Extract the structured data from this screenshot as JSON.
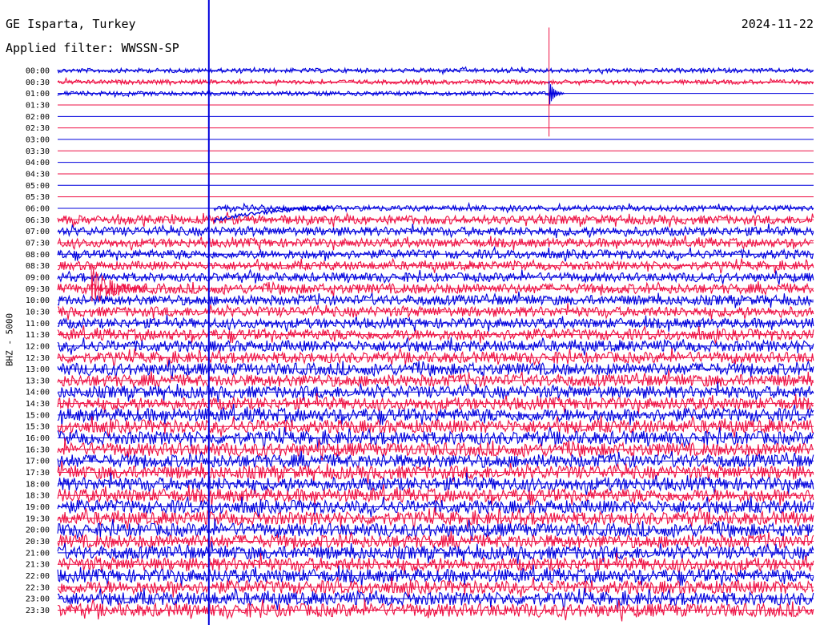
{
  "header": {
    "station": "GE Isparta, Turkey",
    "date": "2024-11-22",
    "filter": "Applied filter: WWSSN-SP"
  },
  "channel_label": "BHZ - 5000",
  "colors": {
    "even_row": "#0000dd",
    "odd_row": "#ee1144",
    "marker": "#0000dd",
    "text": "#000000"
  },
  "chart_data": {
    "type": "line",
    "title": "GE Isparta, Turkey",
    "subtitle": "Applied filter: WWSSN-SP",
    "ylabel": "BHZ - 5000",
    "x_axis": "minutes within each 30-minute trace line (0–30)",
    "y_tick_labels": [
      "00:00",
      "00:30",
      "01:00",
      "01:30",
      "02:00",
      "02:30",
      "03:00",
      "03:30",
      "04:00",
      "04:30",
      "05:00",
      "05:30",
      "06:00",
      "06:30",
      "07:00",
      "07:30",
      "08:00",
      "08:30",
      "09:00",
      "09:30",
      "10:00",
      "10:30",
      "11:00",
      "11:30",
      "12:00",
      "12:30",
      "13:00",
      "13:30",
      "14:00",
      "14:30",
      "15:00",
      "15:30",
      "16:00",
      "16:30",
      "17:00",
      "17:30",
      "18:00",
      "18:30",
      "19:00",
      "19:30",
      "20:00",
      "20:30",
      "21:00",
      "21:30",
      "22:00",
      "22:30",
      "23:00",
      "23:30"
    ],
    "series_colors_alternating": [
      "#0000dd",
      "#ee1144"
    ],
    "rows": [
      {
        "label": "00:00",
        "active": [
          [
            0,
            30
          ]
        ],
        "amp": 0.2
      },
      {
        "label": "00:30",
        "active": [
          [
            0,
            30
          ]
        ],
        "amp": 0.2
      },
      {
        "label": "01:00",
        "active": [
          [
            0,
            19.5
          ]
        ],
        "amp": 0.2
      },
      {
        "label": "01:30",
        "active": [],
        "amp": 0
      },
      {
        "label": "02:00",
        "active": [],
        "amp": 0
      },
      {
        "label": "02:30",
        "active": [],
        "amp": 0
      },
      {
        "label": "03:00",
        "active": [],
        "amp": 0
      },
      {
        "label": "03:30",
        "active": [],
        "amp": 0
      },
      {
        "label": "04:00",
        "active": [],
        "amp": 0
      },
      {
        "label": "04:30",
        "active": [],
        "amp": 0
      },
      {
        "label": "05:00",
        "active": [],
        "amp": 0
      },
      {
        "label": "05:30",
        "active": [],
        "amp": 0
      },
      {
        "label": "06:00",
        "active": [
          [
            6.2,
            30
          ]
        ],
        "amp": 0.25
      },
      {
        "label": "06:30",
        "active": [
          [
            0,
            30
          ]
        ],
        "amp": 0.4
      },
      {
        "label": "07:00",
        "active": [
          [
            0,
            30
          ]
        ],
        "amp": 0.4
      },
      {
        "label": "07:30",
        "active": [
          [
            0,
            30
          ]
        ],
        "amp": 0.4
      },
      {
        "label": "08:00",
        "active": [
          [
            0,
            15.2
          ],
          [
            15.4,
            30
          ]
        ],
        "amp": 0.4
      },
      {
        "label": "08:30",
        "active": [
          [
            0,
            30
          ]
        ],
        "amp": 0.4
      },
      {
        "label": "09:00",
        "active": [
          [
            0,
            30
          ]
        ],
        "amp": 0.4
      },
      {
        "label": "09:30",
        "active": [
          [
            0,
            30
          ]
        ],
        "amp": 0.45
      },
      {
        "label": "10:00",
        "active": [
          [
            0,
            30
          ]
        ],
        "amp": 0.45
      },
      {
        "label": "10:30",
        "active": [
          [
            0,
            30
          ]
        ],
        "amp": 0.45
      },
      {
        "label": "11:00",
        "active": [
          [
            0,
            30
          ]
        ],
        "amp": 0.45
      },
      {
        "label": "11:30",
        "active": [
          [
            0,
            30
          ]
        ],
        "amp": 0.5
      },
      {
        "label": "12:00",
        "active": [
          [
            0,
            30
          ]
        ],
        "amp": 0.5
      },
      {
        "label": "12:30",
        "active": [
          [
            0,
            30
          ]
        ],
        "amp": 0.5
      },
      {
        "label": "13:00",
        "active": [
          [
            0,
            30
          ]
        ],
        "amp": 0.55
      },
      {
        "label": "13:30",
        "active": [
          [
            0,
            30
          ]
        ],
        "amp": 0.55
      },
      {
        "label": "14:00",
        "active": [
          [
            0,
            30
          ]
        ],
        "amp": 0.55
      },
      {
        "label": "14:30",
        "active": [
          [
            0,
            30
          ]
        ],
        "amp": 0.55
      },
      {
        "label": "15:00",
        "active": [
          [
            0,
            30
          ]
        ],
        "amp": 0.6
      },
      {
        "label": "15:30",
        "active": [
          [
            0,
            30
          ]
        ],
        "amp": 0.6
      },
      {
        "label": "16:00",
        "active": [
          [
            0,
            30
          ]
        ],
        "amp": 0.6
      },
      {
        "label": "16:30",
        "active": [
          [
            0,
            30
          ]
        ],
        "amp": 0.6
      },
      {
        "label": "17:00",
        "active": [
          [
            0,
            30
          ]
        ],
        "amp": 0.6
      },
      {
        "label": "17:30",
        "active": [
          [
            0,
            30
          ]
        ],
        "amp": 0.6
      },
      {
        "label": "18:00",
        "active": [
          [
            0,
            30
          ]
        ],
        "amp": 0.6
      },
      {
        "label": "18:30",
        "active": [
          [
            0,
            30
          ]
        ],
        "amp": 0.6
      },
      {
        "label": "19:00",
        "active": [
          [
            0,
            30
          ]
        ],
        "amp": 0.6
      },
      {
        "label": "19:30",
        "active": [
          [
            0,
            30
          ]
        ],
        "amp": 0.6
      },
      {
        "label": "20:00",
        "active": [
          [
            0,
            30
          ]
        ],
        "amp": 0.6
      },
      {
        "label": "20:30",
        "active": [
          [
            0,
            30
          ]
        ],
        "amp": 0.6
      },
      {
        "label": "21:00",
        "active": [
          [
            0,
            30
          ]
        ],
        "amp": 0.6
      },
      {
        "label": "21:30",
        "active": [
          [
            0,
            30
          ]
        ],
        "amp": 0.6
      },
      {
        "label": "22:00",
        "active": [
          [
            0,
            30
          ]
        ],
        "amp": 0.6
      },
      {
        "label": "22:30",
        "active": [
          [
            0,
            30
          ]
        ],
        "amp": 0.6
      },
      {
        "label": "23:00",
        "active": [
          [
            0,
            30
          ]
        ],
        "amp": 0.6
      },
      {
        "label": "23:30",
        "active": [
          [
            0,
            30
          ]
        ],
        "amp": 0.6
      }
    ],
    "events": [
      {
        "row": "00:30",
        "minute": 19.5,
        "type": "spike"
      },
      {
        "row": "06:00",
        "minute": 6.0,
        "type": "spike"
      },
      {
        "row": "09:30",
        "minute": 0.7,
        "type": "burst"
      }
    ],
    "marker_minute": 6.0,
    "gap_dc_recovery": {
      "row": "06:00",
      "start_minute": 6.2,
      "end_minute": 10.8
    }
  }
}
